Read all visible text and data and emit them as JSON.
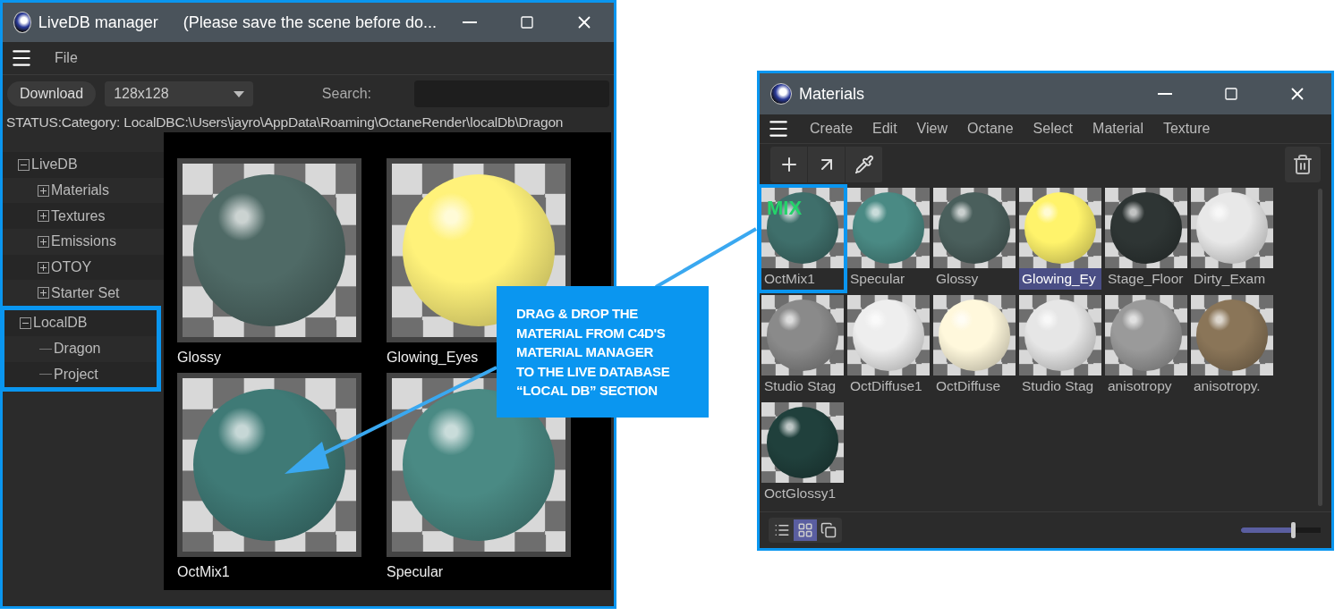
{
  "livedb_window": {
    "title": "LiveDB manager",
    "subtitle": "(Please save the scene before do...",
    "menu": [
      "File"
    ],
    "toolbar": {
      "download_button": "Download",
      "size_dropdown": "128x128",
      "search_label": "Search:"
    },
    "status": "STATUS:Category: LocalDBC:\\Users\\jayro\\AppData\\Roaming\\OctaneRender\\localDb\\Dragon",
    "tree": [
      {
        "label": "LiveDB",
        "expanded": true,
        "highlighted": false,
        "children": [
          {
            "label": "Materials",
            "expanded": false
          },
          {
            "label": "Textures",
            "expanded": false
          },
          {
            "label": "Emissions",
            "expanded": false
          },
          {
            "label": "OTOY",
            "expanded": false
          },
          {
            "label": "Starter Set",
            "expanded": false
          }
        ]
      },
      {
        "label": "LocalDB",
        "expanded": true,
        "highlighted": true,
        "children": [
          {
            "label": "Dragon"
          },
          {
            "label": "Project"
          }
        ]
      }
    ],
    "materials": [
      {
        "name": "Glossy",
        "color": "#4f6a66"
      },
      {
        "name": "Glowing_Eyes",
        "color": "#fff27a"
      },
      {
        "name": "OctMix1",
        "color": "#3f7a76"
      },
      {
        "name": "Specular",
        "color": "#4a8a84"
      }
    ]
  },
  "callout": {
    "text": "DRAG & DROP THE\nMATERIAL FROM C4D'S\nMATERIAL MANAGER\nTO THE LIVE DATABASE\n“LOCAL DB” SECTION"
  },
  "materials_window": {
    "title": "Materials",
    "menu": [
      "Create",
      "Edit",
      "View",
      "Octane",
      "Select",
      "Material",
      "Texture"
    ],
    "materials": [
      {
        "name": "OctMix1",
        "color": "#3f6f6b",
        "badge": "MIX",
        "selected": false,
        "highlighted": true
      },
      {
        "name": "Specular",
        "color": "#4a8a84",
        "selected": false,
        "highlighted": false
      },
      {
        "name": "Glossy",
        "color": "#4a5f5c",
        "selected": false,
        "highlighted": false
      },
      {
        "name": "Glowing_Ey",
        "color": "#fff36b",
        "selected": true,
        "highlighted": false
      },
      {
        "name": "Stage_Floor",
        "color": "#2e3534",
        "selected": false,
        "highlighted": false
      },
      {
        "name": "Dirty_Exam",
        "color": "#e8e8e8",
        "selected": false,
        "highlighted": false
      },
      {
        "name": "Studio Stag",
        "color": "#8a8a8a",
        "selected": false,
        "highlighted": false
      },
      {
        "name": "OctDiffuse1",
        "color": "#eeeeee",
        "selected": false,
        "highlighted": false
      },
      {
        "name": "OctDiffuse",
        "color": "#fff8dc",
        "selected": false,
        "highlighted": false
      },
      {
        "name": "Studio Stag",
        "color": "#e6e6e6",
        "selected": false,
        "highlighted": false
      },
      {
        "name": "anisotropy",
        "color": "#9a9a9a",
        "selected": false,
        "highlighted": false
      },
      {
        "name": "anisotropy.",
        "color": "#8a7558",
        "selected": false,
        "highlighted": false
      },
      {
        "name": "OctGlossy1",
        "color": "#20403c",
        "selected": false,
        "highlighted": false
      }
    ],
    "view_modes": [
      {
        "kind": "list",
        "selected": false
      },
      {
        "kind": "grid",
        "selected": true
      },
      {
        "kind": "single",
        "selected": false
      }
    ],
    "zoom_slider": {
      "level": 0.65
    }
  }
}
